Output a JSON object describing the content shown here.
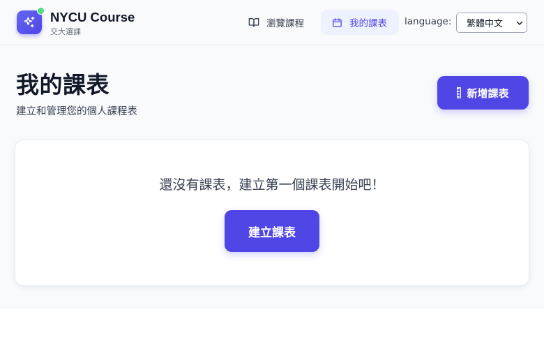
{
  "header": {
    "brand_title": "NYCU Course",
    "brand_subtitle": "交大選課",
    "nav": {
      "browse_label": "瀏覽課程",
      "my_schedule_label": "我的課表"
    },
    "language_label": "language:",
    "language_value": "繁體中文"
  },
  "page": {
    "title": "我的課表",
    "subtitle": "建立和管理您的個人課程表",
    "new_button_label": "新增課表"
  },
  "empty_state": {
    "message": "還沒有課表，建立第一個課表開始吧！",
    "create_button_label": "建立課表"
  },
  "colors": {
    "accent": "#4f46e5",
    "accent_light": "#eef2ff",
    "status_dot": "#4ade80"
  },
  "icons": {
    "logo": "sparkles-icon",
    "browse": "book-open-icon",
    "my_schedule": "calendar-icon",
    "new_schedule": "ruler-icon",
    "select_arrow": "chevron-down-icon"
  }
}
